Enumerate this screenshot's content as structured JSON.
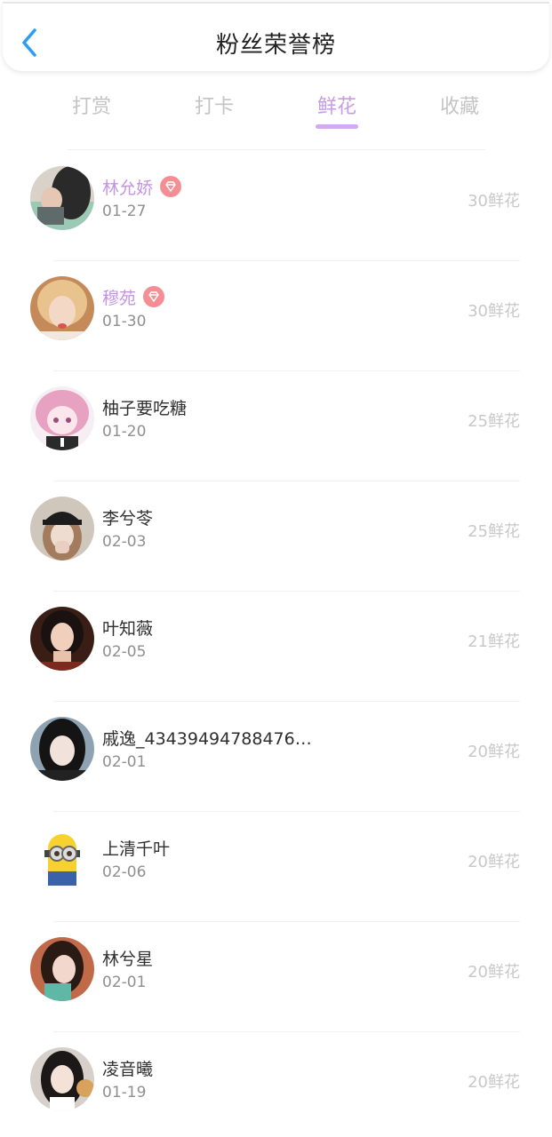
{
  "header": {
    "title": "粉丝荣誉榜",
    "back_icon": "chevron-left-icon",
    "back_color": "#2a9df4"
  },
  "tabs": [
    {
      "label": "打赏",
      "active": false
    },
    {
      "label": "打卡",
      "active": false
    },
    {
      "label": "鲜花",
      "active": true
    },
    {
      "label": "收藏",
      "active": false
    }
  ],
  "colors": {
    "accent": "#c79be6",
    "vip_name": "#c493e4",
    "badge": "#f58e94"
  },
  "fans": [
    {
      "name": "林允娇",
      "date": "01-27",
      "count": "30鲜花",
      "vip": true,
      "badge_icon": "diamond-icon"
    },
    {
      "name": "穆苑",
      "date": "01-30",
      "count": "30鲜花",
      "vip": true,
      "badge_icon": "diamond-icon"
    },
    {
      "name": "柚子要吃糖",
      "date": "01-20",
      "count": "25鲜花",
      "vip": false
    },
    {
      "name": "李兮苓",
      "date": "02-03",
      "count": "25鲜花",
      "vip": false
    },
    {
      "name": "叶知薇",
      "date": "02-05",
      "count": "21鲜花",
      "vip": false
    },
    {
      "name": "戚逸_43439494788476…",
      "date": "02-01",
      "count": "20鲜花",
      "vip": false
    },
    {
      "name": "上清千叶",
      "date": "02-06",
      "count": "20鲜花",
      "vip": false
    },
    {
      "name": "林兮星",
      "date": "02-01",
      "count": "20鲜花",
      "vip": false
    },
    {
      "name": "凌音曦",
      "date": "01-19",
      "count": "20鲜花",
      "vip": false
    }
  ]
}
